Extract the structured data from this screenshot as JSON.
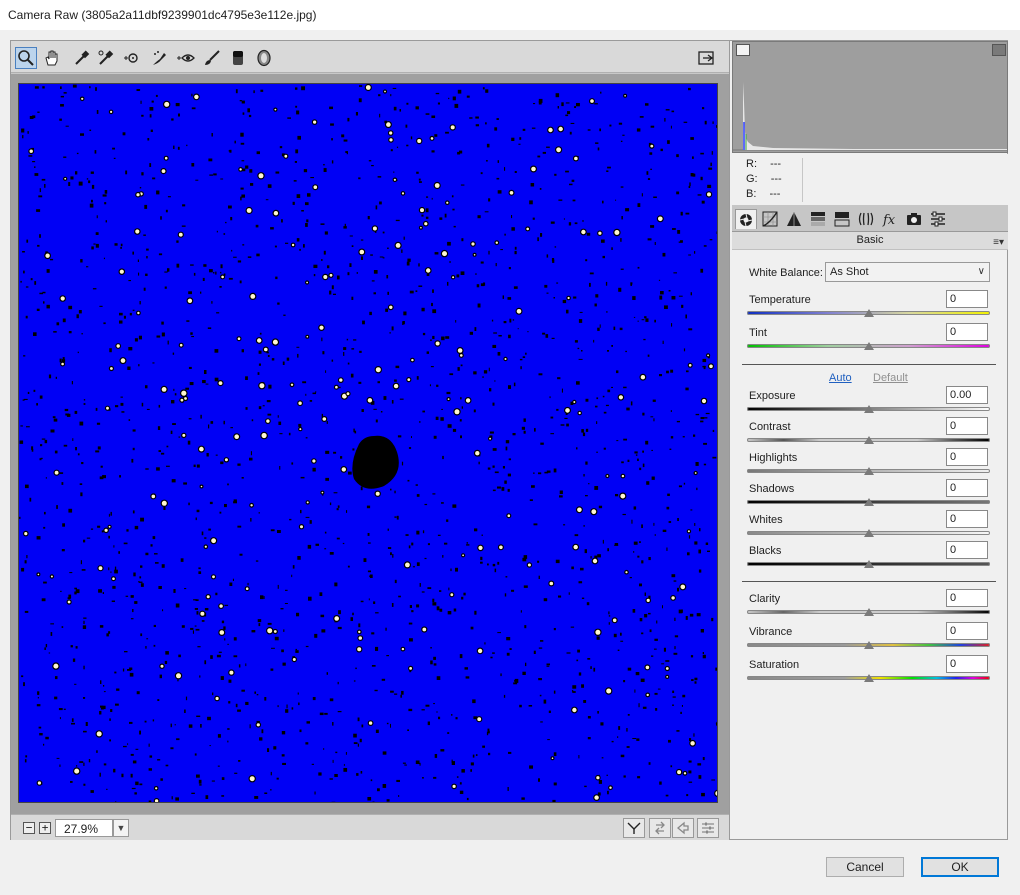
{
  "window": {
    "title": "Camera Raw (3805a2a11dbf9239901dc4795e3e112e.jpg)"
  },
  "toolbar": {
    "tools": [
      {
        "name": "zoom-tool-icon",
        "active": true
      },
      {
        "name": "hand-tool-icon"
      },
      {
        "name": "white-balance-tool-icon"
      },
      {
        "name": "color-sampler-tool-icon"
      },
      {
        "name": "targeted-adjustment-tool-icon"
      },
      {
        "name": "spot-removal-tool-icon"
      },
      {
        "name": "red-eye-removal-tool-icon"
      },
      {
        "name": "adjustment-brush-icon"
      },
      {
        "name": "graduated-filter-icon"
      },
      {
        "name": "radial-filter-icon"
      }
    ],
    "open_preferences_icon": "toggle-fullscreen-icon"
  },
  "bottom_bar": {
    "zoom_out": "−",
    "zoom_in": "+",
    "zoom_value": "27.9%",
    "view_buttons": [
      "before-after-toggle-icon",
      "swap-settings-icon",
      "copy-settings-icon",
      "preview-preferences-icon"
    ]
  },
  "readout": {
    "r_label": "R:",
    "g_label": "G:",
    "b_label": "B:",
    "r": "---",
    "g": "---",
    "b": "---"
  },
  "panel": {
    "tabs": [
      "basic-tab-icon",
      "tone-curve-tab-icon",
      "detail-tab-icon",
      "hsl-tab-icon",
      "split-toning-tab-icon",
      "lens-corrections-tab-icon",
      "effects-tab-icon",
      "camera-calibration-tab-icon",
      "presets-tab-icon"
    ],
    "title": "Basic",
    "menu_icon": "panel-menu-icon",
    "white_balance_label": "White Balance:",
    "white_balance_value": "As Shot",
    "auto_link": "Auto",
    "default_link": "Default",
    "sliders": [
      {
        "key": "temperature",
        "label": "Temperature",
        "value": "0",
        "level": 0.5
      },
      {
        "key": "tint",
        "label": "Tint",
        "value": "0",
        "level": 0.5
      },
      {
        "key": "exposure",
        "label": "Exposure",
        "value": "0.00",
        "level": 0.5
      },
      {
        "key": "contrast",
        "label": "Contrast",
        "value": "0",
        "level": 0.5
      },
      {
        "key": "highlights",
        "label": "Highlights",
        "value": "0",
        "level": 0.5
      },
      {
        "key": "shadows",
        "label": "Shadows",
        "value": "0",
        "level": 0.5
      },
      {
        "key": "whites",
        "label": "Whites",
        "value": "0",
        "level": 0.5
      },
      {
        "key": "blacks",
        "label": "Blacks",
        "value": "0",
        "level": 0.5
      },
      {
        "key": "clarity",
        "label": "Clarity",
        "value": "0",
        "level": 0.5
      },
      {
        "key": "vibrance",
        "label": "Vibrance",
        "value": "0",
        "level": 0.5
      },
      {
        "key": "saturation",
        "label": "Saturation",
        "value": "0",
        "level": 0.5
      }
    ]
  },
  "buttons": {
    "cancel": "Cancel",
    "ok": "OK"
  },
  "colors": {
    "image_blue": "#0000f5",
    "accent": "#0078d7"
  }
}
